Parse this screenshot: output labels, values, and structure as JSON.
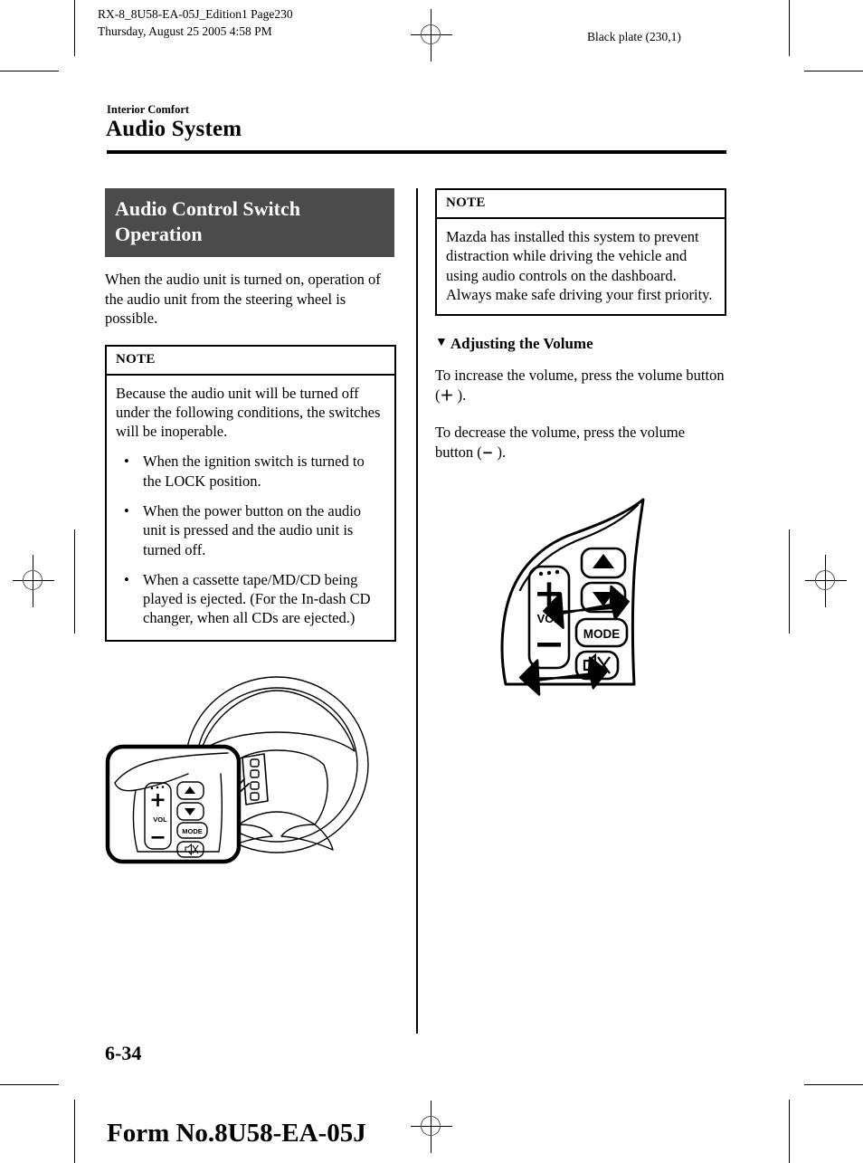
{
  "document": {
    "header_line_1": "RX-8_8U58-EA-05J_Edition1 Page230",
    "header_line_2": "Thursday, August 25 2005 4:58 PM",
    "plate_label": "Black plate (230,1)",
    "section_label": "Interior Comfort",
    "page_title": "Audio System",
    "page_number": "6-34",
    "form_number": "Form No.8U58-EA-05J"
  },
  "left_column": {
    "banner_heading": "Audio Control Switch Operation",
    "intro_paragraph": "When the audio unit is turned on, operation of the audio unit from the steering wheel is possible.",
    "note": {
      "title": "NOTE",
      "intro": "Because the audio unit will be turned off under the following conditions, the switches will be inoperable.",
      "bullets": [
        "When the ignition switch is turned to the LOCK position.",
        "When the power button on the audio unit is pressed and the audio unit is turned off.",
        "When a cassette tape/MD/CD being played is ejected. (For the In-dash CD changer, when all CDs are ejected.)"
      ],
      "bullet_glyph": "•"
    },
    "figure": {
      "name": "steering-wheel-with-audio-switch-callout",
      "callout_labels": {
        "vol": "VOL",
        "mode": "MODE",
        "plus": "+",
        "minus": "−"
      }
    }
  },
  "right_column": {
    "note": {
      "title": "NOTE",
      "lines": [
        "Mazda has installed this system to prevent distraction while driving the vehicle and using audio controls on the dashboard.",
        "Always make safe driving your first priority."
      ]
    },
    "subheading": {
      "triangle": "▼",
      "text": "Adjusting the Volume"
    },
    "paragraph_increase_before": "To increase the volume, press the volume button (",
    "paragraph_increase_symbol": "＋",
    "paragraph_increase_after": " ).",
    "paragraph_decrease_before": "To decrease the volume, press the volume button (",
    "paragraph_decrease_symbol": "−",
    "paragraph_decrease_after": " ).",
    "figure": {
      "name": "audio-control-switch-detail",
      "labels": {
        "vol": "VOL",
        "mode": "MODE",
        "plus": "+",
        "minus": "−"
      }
    }
  },
  "colors": {
    "banner_background": "#4b4b4b",
    "banner_text": "#ffffff",
    "rule": "#000000",
    "page_background": "#ffffff"
  }
}
